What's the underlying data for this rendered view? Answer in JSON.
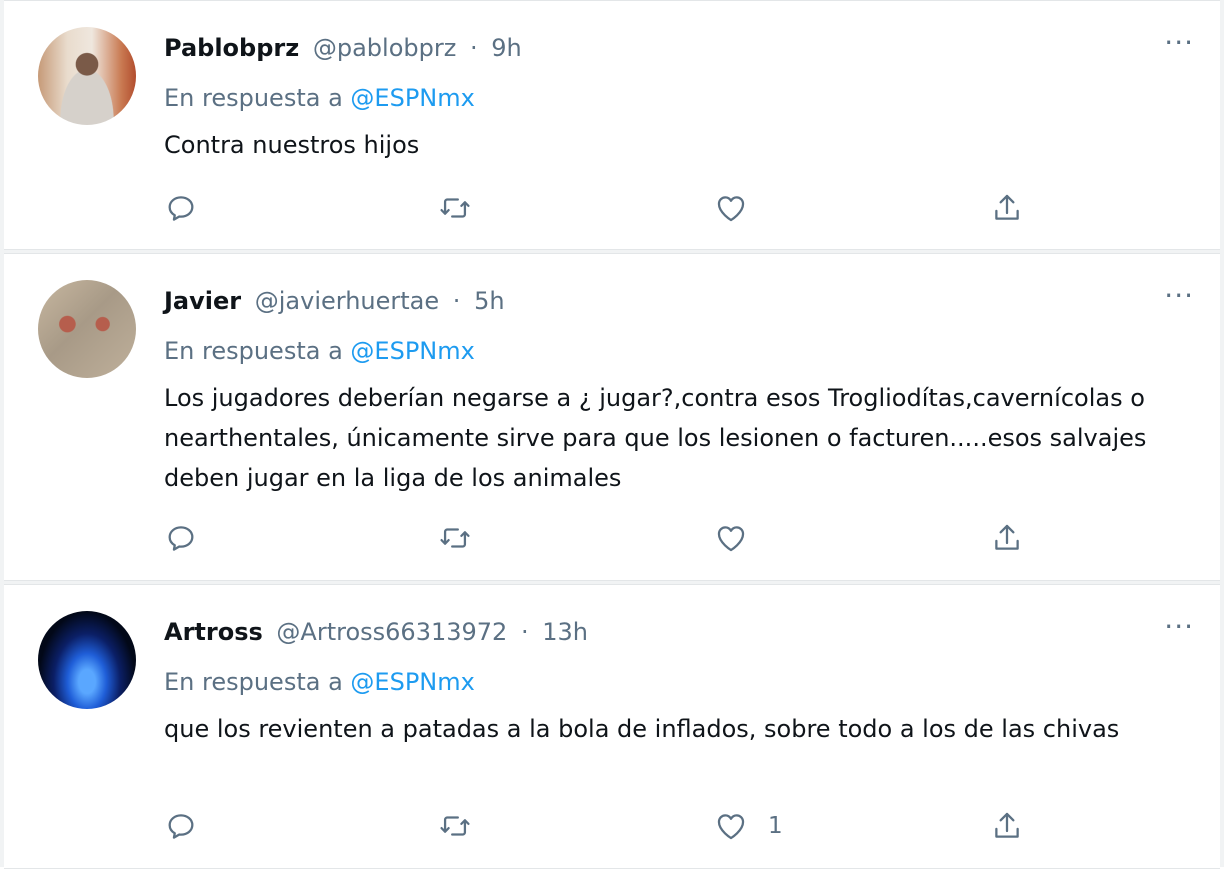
{
  "tweets": [
    {
      "name": "Pablobprz",
      "handle": "@pablobprz",
      "time": "9h",
      "reply_prefix": "En respuesta a",
      "reply_to": "@ESPNmx",
      "text": "Contra nuestros hijos",
      "likes": "",
      "avatar": "photo-avatar"
    },
    {
      "name": "Javier",
      "handle": "@javierhuertae",
      "time": "5h",
      "reply_prefix": "En respuesta a",
      "reply_to": "@ESPNmx",
      "text": "Los jugadores deberían negarse a ¿ jugar?,contra esos Trogliodítas,cavernícolas o nearthentales, únicamente sirve para que los lesionen o facturen.....esos salvajes deben jugar en la liga de los animales",
      "likes": "",
      "avatar": "photo-avatar"
    },
    {
      "name": "Artross",
      "handle": "@Artross66313972",
      "time": "13h",
      "reply_prefix": "En respuesta a",
      "reply_to": "@ESPNmx",
      "text": "que los revienten a patadas a la bola de inflados, sobre todo a los de las chivas",
      "likes": "1",
      "avatar": "blue-light-avatar"
    }
  ],
  "separator": "·",
  "more_glyph": "···",
  "colors": {
    "accent": "#1d9bf0",
    "muted": "#5b7083",
    "text": "#0f1419",
    "border": "#e3e6e8"
  },
  "icons": [
    "reply-icon",
    "retweet-icon",
    "like-icon",
    "share-icon",
    "more-icon"
  ]
}
